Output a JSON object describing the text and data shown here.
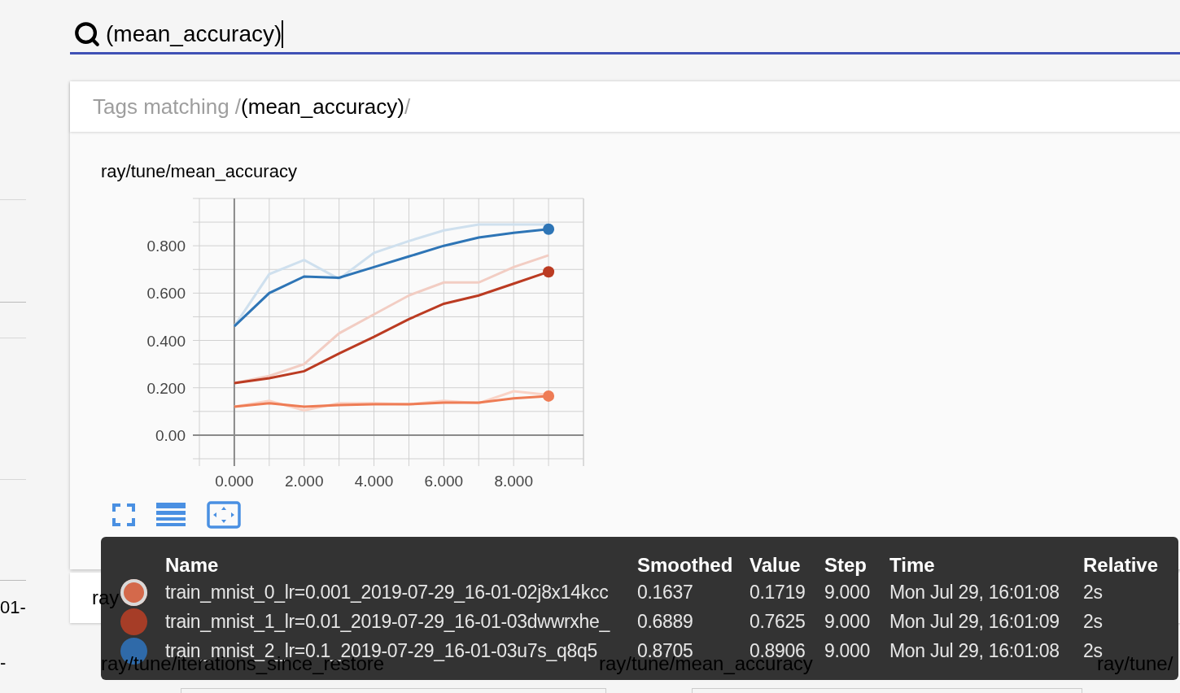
{
  "sidebar": {
    "texts": [
      "01-",
      "-"
    ]
  },
  "search": {
    "value": "(mean_accuracy)"
  },
  "tags_card": {
    "header": {
      "prefix": "Tags matching /",
      "query": "(mean_accuracy)",
      "suffix": "/"
    },
    "chart": {
      "title": "ray/tune/mean_accuracy",
      "chart_data": {
        "type": "line",
        "grid": true,
        "xlim": [
          -1,
          10
        ],
        "ylim": [
          -0.1,
          1.0
        ],
        "xticks": [
          {
            "value": 0,
            "label": "0.000"
          },
          {
            "value": 2,
            "label": "2.000"
          },
          {
            "value": 4,
            "label": "4.000"
          },
          {
            "value": 6,
            "label": "6.000"
          },
          {
            "value": 8,
            "label": "8.000"
          }
        ],
        "yticks": [
          {
            "value": 0,
            "label": "0.00"
          },
          {
            "value": 0.2,
            "label": "0.200"
          },
          {
            "value": 0.4,
            "label": "0.400"
          },
          {
            "value": 0.6,
            "label": "0.600"
          },
          {
            "value": 0.8,
            "label": "0.800"
          }
        ],
        "x": [
          0,
          1,
          2,
          3,
          4,
          5,
          6,
          7,
          8,
          9
        ],
        "series": [
          {
            "color": "#fad3c6",
            "values": [
              0.12,
              0.145,
              0.105,
              0.135,
              0.135,
              0.13,
              0.145,
              0.135,
              0.185,
              0.17
            ]
          },
          {
            "color": "#f2cdc3",
            "values": [
              0.22,
              0.25,
              0.3,
              0.43,
              0.51,
              0.59,
              0.645,
              0.645,
              0.71,
              0.76
            ]
          },
          {
            "color": "#cfe0ee",
            "values": [
              0.46,
              0.68,
              0.74,
              0.66,
              0.77,
              0.82,
              0.865,
              0.89,
              0.89,
              0.89
            ]
          },
          {
            "color": "#ee7c55",
            "values": [
              0.12,
              0.135,
              0.12,
              0.127,
              0.13,
              0.13,
              0.137,
              0.137,
              0.155,
              0.165
            ]
          },
          {
            "color": "#bb3b22",
            "values": [
              0.22,
              0.24,
              0.27,
              0.345,
              0.415,
              0.49,
              0.555,
              0.59,
              0.64,
              0.69
            ]
          },
          {
            "color": "#2e75b6",
            "values": [
              0.46,
              0.6,
              0.67,
              0.665,
              0.71,
              0.755,
              0.8,
              0.835,
              0.855,
              0.87
            ]
          }
        ]
      }
    }
  },
  "next_card": {
    "title": "ray"
  },
  "chart_titles": [
    "ray/tune/iterations_since_restore",
    "ray/tune/mean_accuracy",
    "ray/tune/"
  ],
  "tooltip": {
    "columns": [
      "Name",
      "Smoothed",
      "Value",
      "Step",
      "Time",
      "Relative"
    ],
    "rows": [
      {
        "color": "#d4694b",
        "highlighted": true,
        "cells": [
          "train_mnist_0_lr=0.001_2019-07-29_16-01-02j8x14kcc",
          "0.1637",
          "0.1719",
          "9.000",
          "Mon Jul 29, 16:01:08",
          "2s"
        ]
      },
      {
        "color": "#a63d27",
        "highlighted": false,
        "cells": [
          "train_mnist_1_lr=0.01_2019-07-29_16-01-03dwwrxhe_",
          "0.6889",
          "0.7625",
          "9.000",
          "Mon Jul 29, 16:01:09",
          "2s"
        ]
      },
      {
        "color": "#2f6aa9",
        "highlighted": false,
        "cells": [
          "train_mnist_2_lr=0.1_2019-07-29_16-01-03u7s_q8q5",
          "0.8705",
          "0.8906",
          "9.000",
          "Mon Jul 29, 16:01:08",
          "2s"
        ]
      }
    ]
  }
}
